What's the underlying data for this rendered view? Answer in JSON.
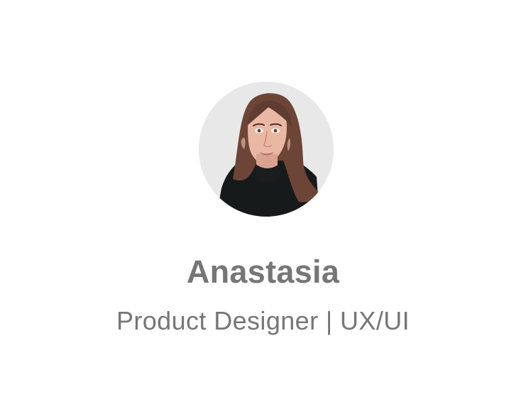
{
  "profile": {
    "name": "Anastasia",
    "role": "Product Designer | UX/UI"
  },
  "colors": {
    "background": "#ffffff",
    "text": "#767676",
    "avatar_background": "#e7e7e7"
  },
  "icons": {
    "avatar": "profile-photo"
  }
}
